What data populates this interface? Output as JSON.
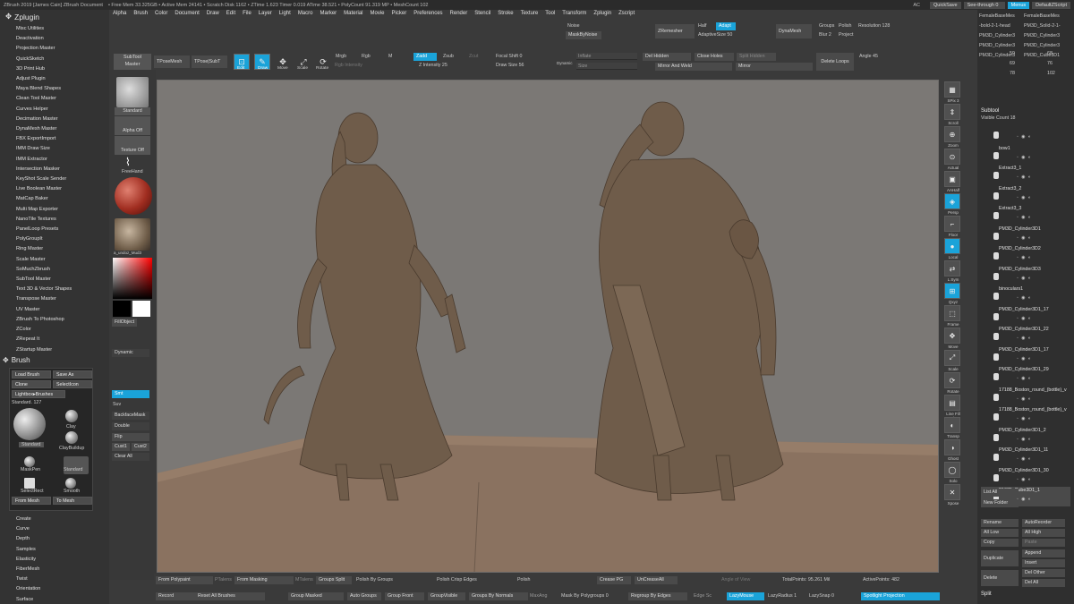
{
  "titlebar": {
    "title": "ZBrush 2019 [James Cain]   ZBrush Document",
    "stats": "• Free Mem 33.325GB • Active Mem 24141 • Scratch Disk 1162 • ZTime 1.623 Timer 0.019 ATime 38.521 • PolyCount 91.319 MP • MeshCount 102",
    "ac": "AC",
    "quicksave": "QuickSave",
    "seethrough": "See-through 0",
    "menus": "Menus",
    "defaultscript": "DefaultZScript"
  },
  "menus": [
    "Alpha",
    "Brush",
    "Color",
    "Document",
    "Draw",
    "Edit",
    "File",
    "Layer",
    "Light",
    "Macro",
    "Marker",
    "Material",
    "Movie",
    "Picker",
    "Preferences",
    "Render",
    "Stencil",
    "Stroke",
    "Texture",
    "Tool",
    "Transform",
    "Zplugin",
    "Zscript"
  ],
  "zplugin": {
    "title": "Zplugin",
    "items": [
      "Misc Utilities",
      "Deactivation",
      "Projection Master",
      "QuickSketch",
      "3D Print Hub",
      "Adjust Plugin",
      "Maya Blend Shapes",
      "Clean Tool Master",
      "Curves Helper",
      "Decimation Master",
      "DynaMesh Master",
      "FBX ExportImport",
      "IMM Draw Size",
      "IMM Extractor",
      "Intersection Masker",
      "KeyShot Scale Sender",
      "Live Boolean Master",
      "MatCap Baker",
      "Multi Map Exporter",
      "NanoTile Textures",
      "PanelLoop Presets",
      "PolyGroupIt",
      "Ring Master",
      "Scale Master",
      "SoMuchZbrush",
      "SubTool Master",
      "Text 3D & Vector Shapes",
      "Transpose Master",
      "UV Master",
      "ZBrush To Photoshop",
      "ZColor",
      "ZRepeat It",
      "ZStartup Master"
    ]
  },
  "brush": {
    "title": "Brush",
    "load": "Load Brush",
    "save_as": "Save As",
    "clone": "Clone",
    "select_icon": "SelectIcon",
    "lightbox": "Lightbox▸Brushes",
    "standard_label": "Standard. 127",
    "thumbs": [
      "Standard",
      "Clay",
      "ClayBuildup",
      "MaskPen",
      "Standard",
      "SelectRect",
      "Smooth"
    ],
    "from_mesh": "From Mesh",
    "to_mesh": "To Mesh"
  },
  "left_bottom": [
    "Create",
    "Curve",
    "Depth",
    "Samples",
    "Elasticity",
    "FiberMesh",
    "Twist",
    "Orientation",
    "Surface",
    "Modifiers"
  ],
  "tooltray": {
    "subtool_master": "SubTool Master",
    "standard": "Standard",
    "alpha_off": "Alpha Off",
    "texture_off": "Texture Off",
    "freehand": "FreeHand",
    "material": "a_undoz_Mud3",
    "fillobject": "FillObject",
    "dynamic": "Dynamic",
    "smt": "Smt",
    "suv": "Suv",
    "backfacemask": "BackfaceMask",
    "double": "Double",
    "flip": "Flip",
    "cust1": "Cust1",
    "cust2": "Cust2",
    "clear_all": "Clear All"
  },
  "topshelf": {
    "tposemesh": "TPoseMesh",
    "tposesubt": "TPose|SubT",
    "edit": "Edit",
    "draw": "Draw",
    "move": "Move",
    "scale": "Scale",
    "rotate": "Rotate",
    "mrgb": "Mrgb",
    "rgb": "Rgb",
    "m": "M",
    "zadd": "Zadd",
    "zsub": "Zsub",
    "zcut": "Zcut",
    "rgb_intensity": "Rgb Intensity",
    "z_intensity": "Z Intensity 25",
    "focal_shift": "Focal Shift 0",
    "draw_size": "Draw Size 56",
    "dynamic": "Dynamic",
    "inflate": "Inflate",
    "size": "Size",
    "del_hidden": "Del Hidden",
    "close_holes": "Close Holes",
    "split_hidden": "Split Hidden",
    "mirror_weld": "Mirror And Weld",
    "mirror": "Mirror",
    "delete_loops": "Delete Loops",
    "angle": "Angle 45",
    "noise": "Noise",
    "mask_by_noise": "MaskByNoise",
    "zremesher": "ZRemesher",
    "half": "Half",
    "adapt": "Adapt",
    "adaptive_size": "AdaptiveSize 50",
    "dynamesh": "DynaMesh",
    "groups": "Groups",
    "polish": "Polish",
    "resolution": "Resolution 128",
    "blur": "Blur 2",
    "project": "Project"
  },
  "righttray": [
    "SPix 3",
    "Scroll",
    "Zoom",
    "Actual",
    "AAHalf",
    "Persp",
    "Floor",
    "Local",
    "L.Sym",
    "Qxyz",
    "Frame",
    "Move",
    "Scale",
    "Rotate",
    "Line Fill PolyF",
    "Transp",
    "Ghost",
    "Solo",
    "Xpose"
  ],
  "subtool": {
    "top_names": [
      "FemaleBaseMes",
      "FemaleBaseMes",
      "-bold-2-1-head",
      "PM3D_Solid-2-1-",
      "PM3D_Cylinder3",
      "PM3D_Cylinder3",
      "PM3D_Cylinder3",
      "PM3D_Cylinder3",
      "PM3D_Cylinder3",
      "PM3D_Cube3D1"
    ],
    "top_nums": [
      "59",
      "68",
      "69",
      "76",
      "78",
      "102"
    ],
    "section": "Subtool",
    "visible_count": "Visible Count 18",
    "items": [
      "",
      "bow1",
      "Extract3_1",
      "Extract3_2",
      "Extract3_3",
      "PM3D_Cylinder3D1",
      "PM3D_Cylinder3D2",
      "PM3D_Cylinder3D3",
      "binoculars1",
      "PM3D_Cylinder3D1_17",
      "PM3D_Cylinder3D1_22",
      "PM3D_Cylinder3D1_17",
      "PM3D_Cylinder3D1_29",
      "17188_Boston_round_(bottle)_v",
      "17188_Boston_round_(bottle)_v",
      "PM3D_Cylinder3D1_2",
      "PM3D_Cylinder3D1_11",
      "PM3D_Cylinder3D1_30",
      "PM3D_Cube3D1_1"
    ],
    "list_all": "List All",
    "autoreorder": "AutoReorder",
    "new_folder": "New Folder",
    "rename": "Rename",
    "all_low": "All Low",
    "all_high": "All High",
    "copy": "Copy",
    "paste": "Paste",
    "duplicate": "Duplicate",
    "append": "Append",
    "insert": "Insert",
    "delete": "Delete",
    "del_other": "Del Other",
    "del_all": "Del All",
    "split": "Split"
  },
  "bottom": {
    "from_polypaint": "From Polypaint",
    "ptalens": "PTalens",
    "from_masking": "From Masking",
    "mtalens": "MTalens",
    "groups_split": "Groups Split",
    "polish_by_groups": "Polish By Groups",
    "polish_crisp": "Polish Crisp Edges",
    "polish": "Polish",
    "crease_pg": "Crease PG",
    "uncreaseall": "UnCreaseAll",
    "angle_of_view": "Angle of View",
    "total_points": "TotalPoints: 95.261 Mil",
    "active_points": "ActivePoints: 482",
    "record": "Record",
    "reset_brushes": "Reset All Brushes",
    "group_masked": "Group Masked",
    "auto_groups": "Auto Groups",
    "group_front": "Group Front",
    "group_visible": "GroupVisible",
    "groups_by_normals": "Groups By Normals",
    "maxangle": "MaxAng",
    "mask_by_polygroups": "Mask By Polygroups 0",
    "regroup_by_edges": "Regroup By Edges",
    "edge_sc": "Edge Sc",
    "lazymouse": "LazyMouse",
    "lazyradius": "LazyRadius 1",
    "lazysnap": "LazySnap 0",
    "spotlight": "Spotlight Projection"
  },
  "colors": {
    "accent": "#1aa3d9",
    "sculpt": "#7a6655",
    "floor": "#8a7260"
  }
}
